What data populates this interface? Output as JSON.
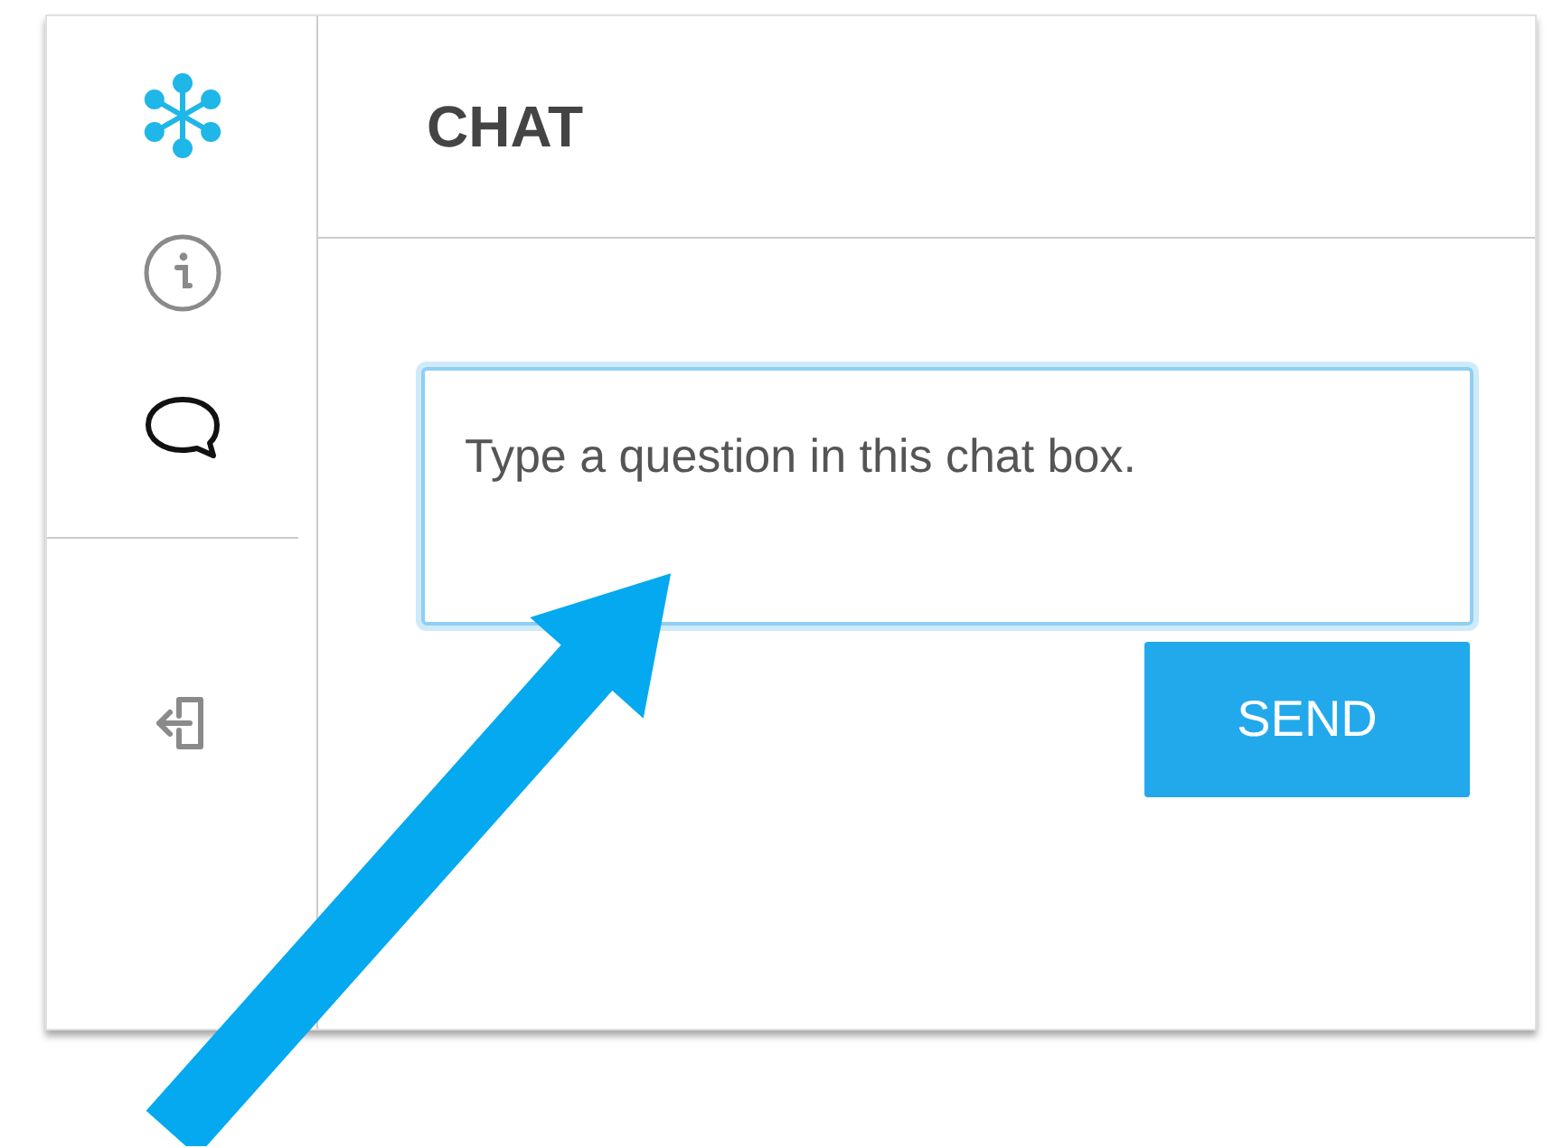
{
  "sidebar": {
    "nav_items": [
      {
        "kind": "info",
        "selected": false
      },
      {
        "kind": "chat",
        "selected": true
      }
    ]
  },
  "panel": {
    "title": "CHAT"
  },
  "chat_box": {
    "value": "Type a question in this chat box."
  },
  "send_button": {
    "label": "SEND"
  }
}
